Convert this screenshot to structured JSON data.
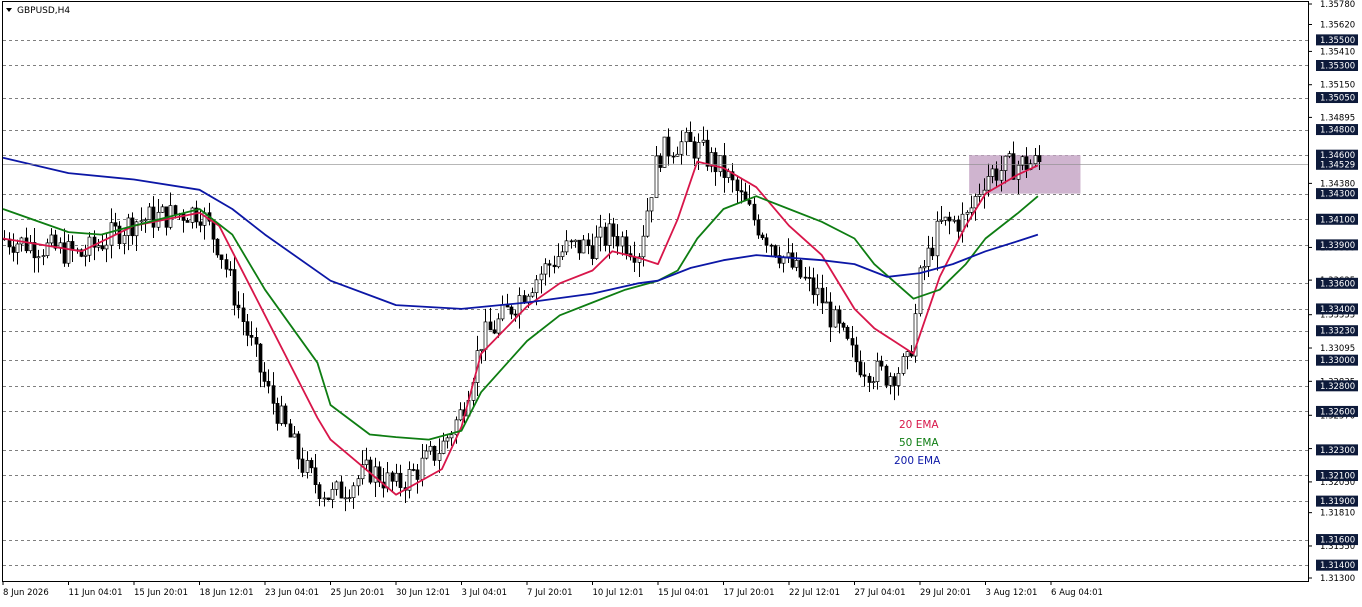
{
  "header": {
    "symbol_label": "GBPUSD,H4",
    "menu_icon": "triangle-down-icon"
  },
  "colors": {
    "background": "#ffffff",
    "candle": "#000000",
    "ema20": "#d8164a",
    "ema50": "#0e7d12",
    "ema200": "#0c17a6",
    "zone_fill": "#c7a7c7",
    "level_badge": "#0d1a3a",
    "grid": "#000000"
  },
  "chart_data": {
    "type": "line",
    "title": "GBPUSD,H4",
    "xlabel": "",
    "ylabel": "",
    "ylim": [
      1.313,
      1.3578
    ],
    "x_categories": [
      "8 Jun 2026",
      "11 Jun 04:01",
      "15 Jun 20:01",
      "18 Jun 12:01",
      "23 Jun 04:01",
      "25 Jun 20:01",
      "30 Jun 12:01",
      "3 Jul 04:01",
      "7 Jul 20:01",
      "10 Jul 12:01",
      "15 Jul 04:01",
      "17 Jul 20:01",
      "22 Jul 12:01",
      "27 Jul 04:01",
      "29 Jul 20:01",
      "3 Aug 12:01",
      "6 Aug 04:01"
    ],
    "price_axis_labels": [
      "1.35780",
      "1.35620",
      "1.35410",
      "1.35150",
      "1.34895",
      "1.34380",
      "1.33880",
      "1.33625",
      "1.33355",
      "1.33095",
      "1.32835",
      "1.32570",
      "1.32310",
      "1.32050",
      "1.31810",
      "1.31550",
      "1.31300"
    ],
    "levels": [
      "1.35500",
      "1.35300",
      "1.35050",
      "1.34800",
      "1.34600",
      "1.34300",
      "1.34100",
      "1.33900",
      "1.33600",
      "1.33400",
      "1.33230",
      "1.33000",
      "1.32800",
      "1.32600",
      "1.32300",
      "1.32100",
      "1.31900",
      "1.31600",
      "1.31400"
    ],
    "current_price": "1.34529",
    "legend": [
      "20 EMA",
      "50 EMA",
      "200 EMA"
    ],
    "series": [
      {
        "name": "20 EMA",
        "color": "#d8164a",
        "x": [
          0,
          1.2,
          2,
          3,
          3.3,
          4,
          4.8,
          5,
          6,
          6.7,
          7,
          7.3,
          8,
          8.5,
          9,
          9.3,
          9.7,
          10,
          10.3,
          10.6,
          11,
          11.5,
          12,
          12.5,
          13,
          13.3,
          13.9,
          14,
          14.3,
          14.7,
          15,
          15.5,
          15.8
        ],
        "y": [
          1.3395,
          1.3385,
          1.3405,
          1.3415,
          1.3405,
          1.3335,
          1.3255,
          1.3238,
          1.3195,
          1.3215,
          1.3248,
          1.3305,
          1.3342,
          1.336,
          1.337,
          1.3385,
          1.338,
          1.3375,
          1.341,
          1.3455,
          1.345,
          1.3435,
          1.3405,
          1.3382,
          1.334,
          1.3325,
          1.3305,
          1.332,
          1.3365,
          1.3405,
          1.343,
          1.3445,
          1.3452
        ]
      },
      {
        "name": "50 EMA",
        "color": "#0e7d12",
        "x": [
          0,
          1,
          1.5,
          2,
          3,
          3.5,
          4,
          4.8,
          5,
          5.6,
          6,
          6.5,
          7,
          7.3,
          8,
          8.5,
          9,
          9.5,
          10,
          10.3,
          10.6,
          11,
          11.5,
          12,
          12.5,
          13,
          13.3,
          13.9,
          14.3,
          14.7,
          15,
          15.5,
          15.8
        ],
        "y": [
          1.3418,
          1.34,
          1.3398,
          1.3405,
          1.3418,
          1.3398,
          1.3355,
          1.3298,
          1.3265,
          1.3242,
          1.324,
          1.3238,
          1.3245,
          1.3275,
          1.3315,
          1.3335,
          1.3345,
          1.3355,
          1.3362,
          1.337,
          1.3395,
          1.3418,
          1.3428,
          1.3418,
          1.3408,
          1.3395,
          1.3375,
          1.3348,
          1.3355,
          1.3375,
          1.3395,
          1.3415,
          1.3428
        ]
      },
      {
        "name": "200 EMA",
        "color": "#0c17a6",
        "x": [
          0,
          1,
          2,
          3,
          3.5,
          4,
          5,
          6,
          7,
          8,
          9,
          9.7,
          10,
          10.5,
          11,
          11.5,
          12,
          12.5,
          13,
          13.5,
          14,
          14.5,
          15,
          15.5,
          15.8
        ],
        "y": [
          1.3458,
          1.3446,
          1.3441,
          1.3433,
          1.3418,
          1.3398,
          1.3362,
          1.3343,
          1.334,
          1.3345,
          1.3352,
          1.336,
          1.3362,
          1.3372,
          1.3378,
          1.3382,
          1.338,
          1.3378,
          1.3375,
          1.3365,
          1.3368,
          1.3375,
          1.3385,
          1.3393,
          1.3398
        ]
      }
    ],
    "x_axis_range": [
      0,
      17
    ],
    "grid": "horizontal dashed at marked levels",
    "legend_placement": "center-bottom"
  }
}
